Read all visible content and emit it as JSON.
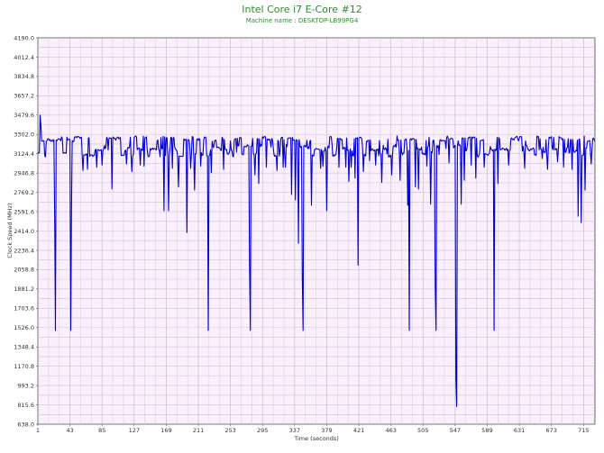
{
  "chart_data": {
    "type": "line",
    "title": "Intel Core i7 E-Core #12",
    "subtitle": "Machine name : DESKTOP-LB99PG4",
    "xlabel": "Time (seconds)",
    "ylabel": "Clock Speed (MHz)",
    "xlim": [
      1,
      730
    ],
    "ylim": [
      638.0,
      4190.0
    ],
    "grid": true,
    "x_ticks": [
      1,
      43,
      85,
      127,
      169,
      211,
      253,
      295,
      337,
      379,
      421,
      463,
      505,
      547,
      589,
      631,
      673,
      715
    ],
    "y_ticks": [
      638.0,
      815.6,
      993.2,
      1170.8,
      1348.4,
      1526.0,
      1703.6,
      1881.2,
      2058.8,
      2236.4,
      2414.0,
      2591.6,
      2769.2,
      2946.8,
      3124.4,
      3302.0,
      3479.6,
      3657.2,
      3834.8,
      4012.4,
      4190.0
    ],
    "series": [
      {
        "color": "#0000cc",
        "baseline": 3260,
        "dips": [
          [
            4,
            3480
          ],
          [
            5,
            3380
          ],
          [
            23,
            2500
          ],
          [
            24,
            1500
          ],
          [
            44,
            1500
          ],
          [
            45,
            2600
          ],
          [
            60,
            2970
          ],
          [
            66,
            2980
          ],
          [
            78,
            3000
          ],
          [
            85,
            3020
          ],
          [
            98,
            2800
          ],
          [
            117,
            3030
          ],
          [
            124,
            2960
          ],
          [
            135,
            3020
          ],
          [
            140,
            3010
          ],
          [
            166,
            2600
          ],
          [
            172,
            2600
          ],
          [
            177,
            2990
          ],
          [
            185,
            2820
          ],
          [
            196,
            2400
          ],
          [
            201,
            2990
          ],
          [
            206,
            2790
          ],
          [
            214,
            3010
          ],
          [
            224,
            1500
          ],
          [
            228,
            2950
          ],
          [
            244,
            2980
          ],
          [
            278,
            2100
          ],
          [
            279,
            1500
          ],
          [
            285,
            2930
          ],
          [
            290,
            2850
          ],
          [
            300,
            3000
          ],
          [
            314,
            2970
          ],
          [
            322,
            3000
          ],
          [
            325,
            3000
          ],
          [
            333,
            2750
          ],
          [
            338,
            2700
          ],
          [
            342,
            2300
          ],
          [
            347,
            2000
          ],
          [
            348,
            1500
          ],
          [
            359,
            2650
          ],
          [
            371,
            2990
          ],
          [
            374,
            3010
          ],
          [
            379,
            2600
          ],
          [
            395,
            3000
          ],
          [
            404,
            3000
          ],
          [
            408,
            2870
          ],
          [
            411,
            3000
          ],
          [
            416,
            2900
          ],
          [
            420,
            2100
          ],
          [
            427,
            2960
          ],
          [
            435,
            3060
          ],
          [
            443,
            3020
          ],
          [
            451,
            2860
          ],
          [
            464,
            2930
          ],
          [
            475,
            2880
          ],
          [
            485,
            2650
          ],
          [
            487,
            1500
          ],
          [
            495,
            2820
          ],
          [
            499,
            2800
          ],
          [
            510,
            3010
          ],
          [
            515,
            2660
          ],
          [
            521,
            1900
          ],
          [
            522,
            1500
          ],
          [
            539,
            3040
          ],
          [
            548,
            1050
          ],
          [
            549,
            800
          ],
          [
            555,
            2660
          ],
          [
            559,
            2880
          ],
          [
            568,
            3020
          ],
          [
            574,
            2900
          ],
          [
            585,
            3000
          ],
          [
            598,
            1500
          ],
          [
            603,
            2850
          ],
          [
            617,
            3020
          ],
          [
            638,
            2990
          ],
          [
            661,
            3080
          ],
          [
            668,
            2980
          ],
          [
            681,
            3050
          ],
          [
            689,
            3000
          ],
          [
            700,
            2980
          ],
          [
            708,
            2550
          ],
          [
            712,
            2490
          ],
          [
            717,
            2790
          ],
          [
            725,
            3030
          ]
        ]
      }
    ]
  }
}
